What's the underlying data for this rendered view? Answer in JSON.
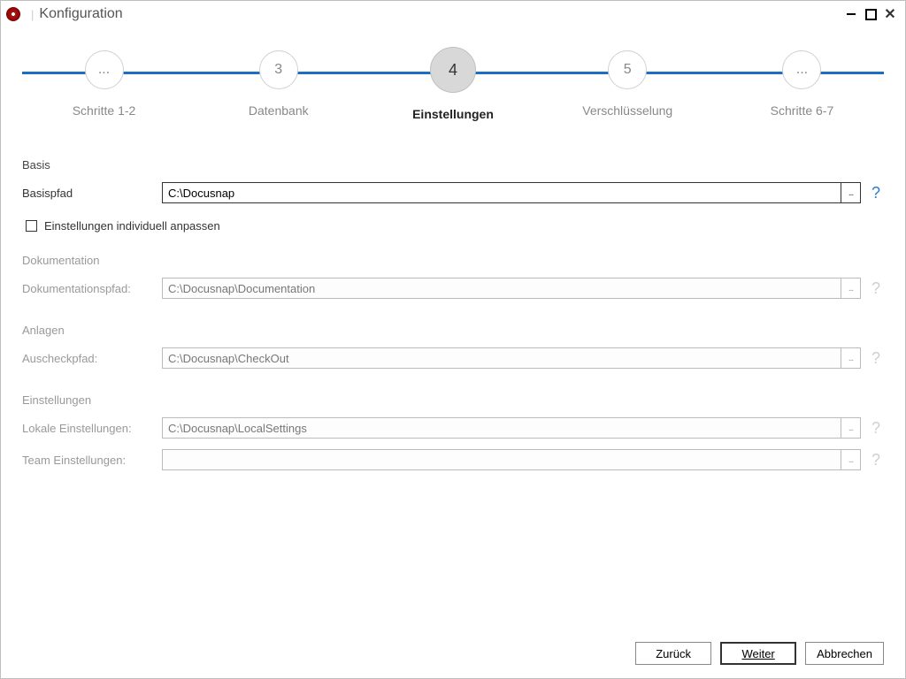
{
  "window": {
    "title": "Konfiguration"
  },
  "steps": [
    {
      "num": "...",
      "label": "Schritte 1-2"
    },
    {
      "num": "3",
      "label": "Datenbank"
    },
    {
      "num": "4",
      "label": "Einstellungen"
    },
    {
      "num": "5",
      "label": "Verschlüsselung"
    },
    {
      "num": "...",
      "label": "Schritte 6-7"
    }
  ],
  "basis": {
    "heading": "Basis",
    "label": "Basispfad",
    "value": "C:\\Docusnap",
    "checkbox_label": "Einstellungen individuell anpassen"
  },
  "dokumentation": {
    "heading": "Dokumentation",
    "label": "Dokumentationspfad:",
    "value": "C:\\Docusnap\\Documentation"
  },
  "anlagen": {
    "heading": "Anlagen",
    "label": "Auscheckpfad:",
    "value": "C:\\Docusnap\\CheckOut"
  },
  "einstellungen": {
    "heading": "Einstellungen",
    "lokale_label": "Lokale Einstellungen:",
    "lokale_value": "C:\\Docusnap\\LocalSettings",
    "team_label": "Team Einstellungen:",
    "team_value": ""
  },
  "footer": {
    "back": "Zurück",
    "next": "Weiter",
    "cancel": "Abbrechen"
  },
  "icons": {
    "browse": "...",
    "help": "?"
  }
}
